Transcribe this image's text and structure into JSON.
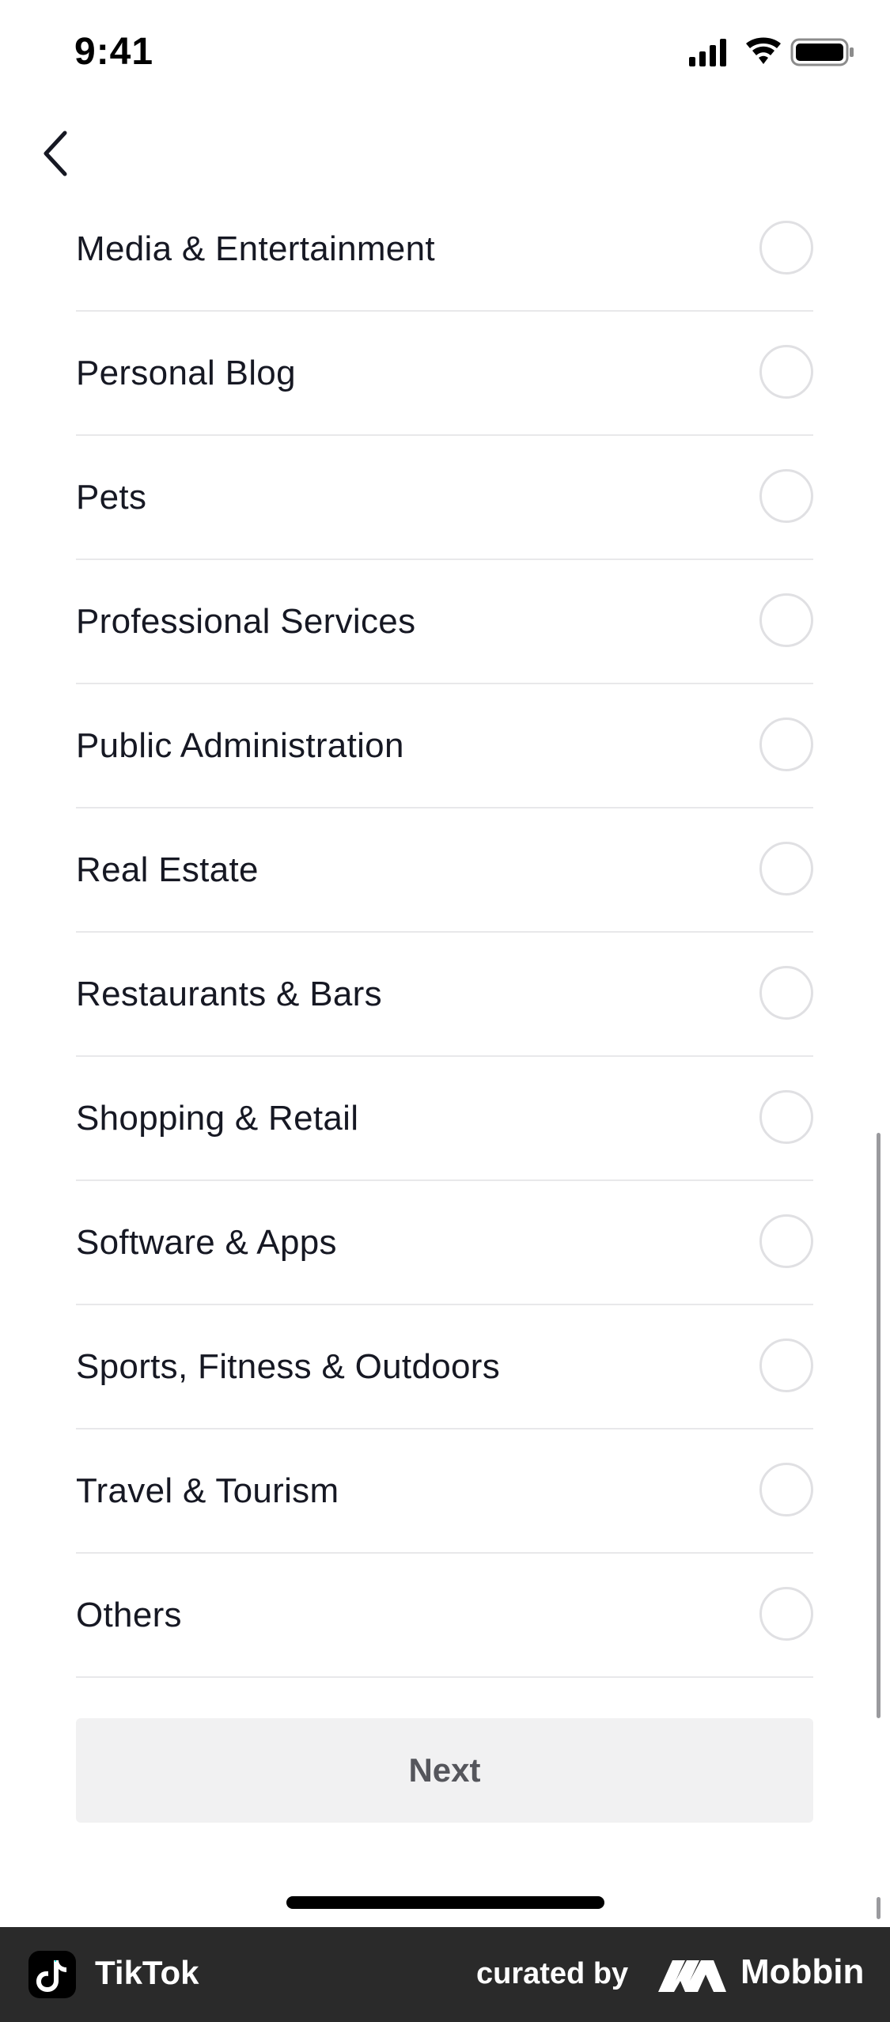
{
  "status_bar": {
    "time": "9:41",
    "icons": [
      "signal-icon",
      "wifi-icon",
      "battery-icon"
    ]
  },
  "nav": {
    "back_icon": "chevron-left-icon"
  },
  "categories": [
    {
      "label": "Media & Entertainment",
      "selected": false
    },
    {
      "label": "Personal Blog",
      "selected": false
    },
    {
      "label": "Pets",
      "selected": false
    },
    {
      "label": "Professional Services",
      "selected": false
    },
    {
      "label": "Public Administration",
      "selected": false
    },
    {
      "label": "Real Estate",
      "selected": false
    },
    {
      "label": "Restaurants & Bars",
      "selected": false
    },
    {
      "label": "Shopping & Retail",
      "selected": false
    },
    {
      "label": "Software & Apps",
      "selected": false
    },
    {
      "label": "Sports, Fitness & Outdoors",
      "selected": false
    },
    {
      "label": "Travel & Tourism",
      "selected": false
    },
    {
      "label": "Others",
      "selected": false
    }
  ],
  "actions": {
    "next_label": "Next"
  },
  "footer": {
    "app_name": "TikTok",
    "curated_by": "curated by",
    "brand": "Mobbin"
  },
  "colors": {
    "background": "#ffffff",
    "text": "#161823",
    "divider": "#e8e8ea",
    "button_bg": "#f1f1f2",
    "button_text": "#55565c",
    "footer_bg": "#2a2a2a"
  }
}
